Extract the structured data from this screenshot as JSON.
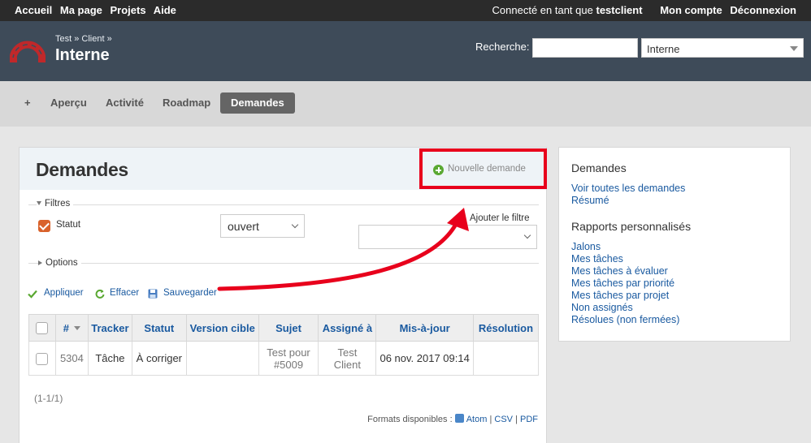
{
  "top_menu": {
    "items": [
      "Accueil",
      "Ma page",
      "Projets",
      "Aide"
    ],
    "logged_as_prefix": "Connecté en tant que",
    "user": "testclient",
    "my_account": "Mon compte",
    "logout": "Déconnexion"
  },
  "header": {
    "breadcrumb": "Test » Client »",
    "project": "Interne",
    "search_label": "Recherche:",
    "search_value": "",
    "project_jump": "Interne"
  },
  "main_menu": {
    "new": "+",
    "overview": "Aperçu",
    "activity": "Activité",
    "roadmap": "Roadmap",
    "issues": "Demandes"
  },
  "content": {
    "title": "Demandes",
    "new_issue": "Nouvelle demande",
    "filters_legend": "Filtres",
    "status_label": "Statut",
    "status_value": "ouvert",
    "add_filter": "Ajouter le filtre",
    "options_legend": "Options",
    "apply": "Appliquer",
    "clear": "Effacer",
    "save": "Sauvegarder",
    "columns": [
      "#",
      "Tracker",
      "Statut",
      "Version cible",
      "Sujet",
      "Assigné à",
      "Mis-à-jour",
      "Résolution"
    ],
    "rows": [
      {
        "id": "5304",
        "tracker": "Tâche",
        "status": "À corriger",
        "version": "",
        "subject_1": "Test pour",
        "subject_2": "#5009",
        "assignee_1": "Test",
        "assignee_2": "Client",
        "updated": "06 nov. 2017 09:14",
        "resolution": ""
      }
    ],
    "pagination": "(1-1/1)",
    "formats_label": "Formats disponibles :",
    "formats": [
      "Atom",
      "CSV",
      "PDF"
    ]
  },
  "sidebar": {
    "issues_title": "Demandes",
    "issues_links": [
      "Voir toutes les demandes",
      "Résumé"
    ],
    "reports_title": "Rapports personnalisés",
    "reports_links": [
      "Jalons",
      "Mes tâches",
      "Mes tâches à évaluer",
      "Mes tâches par priorité",
      "Mes tâches par projet",
      "Non assignés",
      "Résolues (non fermées)"
    ]
  },
  "colors": {
    "top_bar": "#2b2b2b",
    "header": "#3e4b59",
    "link": "#1a5aa0",
    "highlight": "#e8001c",
    "status_check": "#d9622b"
  }
}
